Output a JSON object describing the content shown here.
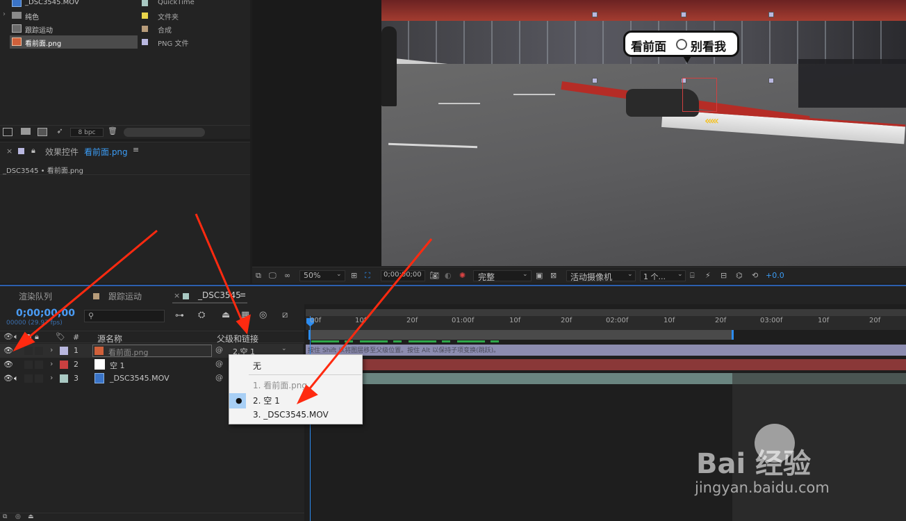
{
  "project": {
    "items": [
      {
        "name": "_DSC3545.MOV",
        "type": "QuickTime",
        "label_color": "#a9c9c3"
      },
      {
        "name": "纯色",
        "type": "文件夹",
        "label_color": "#e8d44a"
      },
      {
        "name": "跟踪运动",
        "type": "合成",
        "label_color": "#b79c7a"
      },
      {
        "name": "看前面.png",
        "type": "PNG 文件",
        "label_color": "#b9b8e0"
      }
    ],
    "bpc": "8 bpc"
  },
  "effects": {
    "title_prefix": "效果控件",
    "title_layer": "看前面.png",
    "breadcrumb": "_DSC3545 • 看前面.png"
  },
  "viewer": {
    "bubble_left": "看前面",
    "bubble_right": "别看我",
    "zoom": "50%",
    "timecode": "0;00;00;00",
    "quality": "完整",
    "camera": "活动摄像机",
    "views": "1 个...",
    "exposure": "+0.0"
  },
  "timeline": {
    "tabs": [
      "渲染队列",
      "跟踪运动",
      "_DSC3545"
    ],
    "timecode": "0;00;00;00",
    "frames": "00000 (29.97 fps)",
    "col_num": "#",
    "col_source": "源名称",
    "col_parent": "父级和链接",
    "ruler": [
      "00f",
      "10f",
      "20f",
      "01:00f",
      "10f",
      "20f",
      "02:00f",
      "10f",
      "20f",
      "03:00f",
      "10f",
      "20f"
    ],
    "hint": "按住 Shift 以将图层移至父级位置。按住 Alt 以保持子项变换(跳跃)。",
    "layers": [
      {
        "num": "1",
        "name": "看前面.png",
        "parent": "2.空 1",
        "label_color": "#b9b8e0"
      },
      {
        "num": "2",
        "name": "空 1",
        "parent": "",
        "label_color": "#c94040"
      },
      {
        "num": "3",
        "name": "_DSC3545.MOV",
        "parent": "",
        "label_color": "#a9c9c3"
      }
    ]
  },
  "parent_menu": {
    "items": [
      {
        "label": "无",
        "disabled": false,
        "checked": false
      },
      {
        "label": "1. 看前面.png",
        "disabled": true,
        "checked": false
      },
      {
        "label": "2. 空 1",
        "disabled": false,
        "checked": true
      },
      {
        "label": "3. _DSC3545.MOV",
        "disabled": false,
        "checked": false
      }
    ]
  },
  "watermark": {
    "brand": "Bai 经验",
    "url": "jingyan.baidu.com"
  },
  "colors": {
    "accent": "#2c8cf0",
    "arrow": "#ff2a10",
    "timecode": "#4a9cf5"
  }
}
